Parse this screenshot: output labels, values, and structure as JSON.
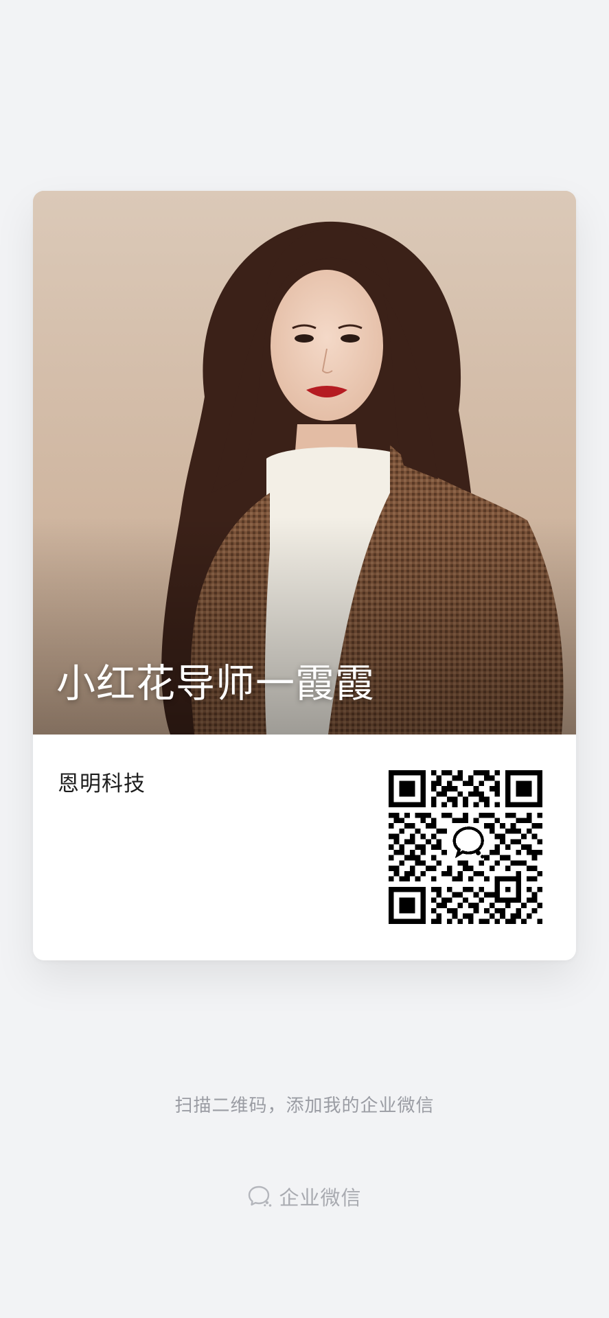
{
  "card": {
    "name": "小红花导师一霞霞",
    "company": "恩明科技",
    "photo_icon": "portrait-photo",
    "qr_icon": "qr-code"
  },
  "hint": "扫描二维码，添加我的企业微信",
  "footer": {
    "brand_label": "企业微信",
    "brand_icon": "wecom-icon"
  },
  "colors": {
    "background": "#f2f3f5",
    "card": "#ffffff",
    "hint_text": "#9a9ca3"
  }
}
